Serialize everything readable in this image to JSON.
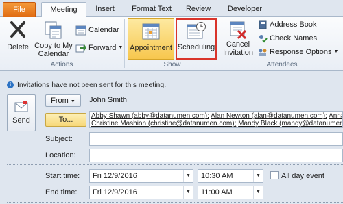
{
  "tabs": {
    "file": "File",
    "meeting": "Meeting",
    "insert": "Insert",
    "format_text": "Format Text",
    "review": "Review",
    "developer": "Developer"
  },
  "ribbon": {
    "actions": {
      "label": "Actions",
      "delete": "Delete",
      "copy_to_my_calendar_1": "Copy to My",
      "copy_to_my_calendar_2": "Calendar",
      "calendar": "Calendar",
      "forward": "Forward"
    },
    "show": {
      "label": "Show",
      "appointment": "Appointment",
      "scheduling": "Scheduling"
    },
    "attendees": {
      "label": "Attendees",
      "cancel_invitation_1": "Cancel",
      "cancel_invitation_2": "Invitation",
      "address_book": "Address Book",
      "check_names": "Check Names",
      "response_options": "Response Options"
    }
  },
  "info_bar": "Invitations have not been sent for this meeting.",
  "form": {
    "send": "Send",
    "from_button": "From",
    "from_value": "John Smith",
    "to_button": "To...",
    "to_line1": [
      "Abby Shawn (abby@datanumen.com);",
      "Alan Newton (alan@datanumen.com);",
      "Anna"
    ],
    "to_line2": [
      "Christine Mashion (christine@datanumen.com);",
      "Mandy Black (mandy@datanumen.com);"
    ],
    "subject_label": "Subject:",
    "subject_value": "",
    "location_label": "Location:",
    "location_value": "",
    "start_label": "Start time:",
    "start_date": "Fri 12/9/2016",
    "start_time": "10:30 AM",
    "end_label": "End time:",
    "end_date": "Fri 12/9/2016",
    "end_time": "11:00 AM",
    "all_day_label": "All day event",
    "all_day_checked": false
  },
  "colors": {
    "file_tab": "#e06b12",
    "selected_button": "#f7c74e",
    "red_highlight": "#d9342b",
    "info_icon": "#2b72c4"
  }
}
